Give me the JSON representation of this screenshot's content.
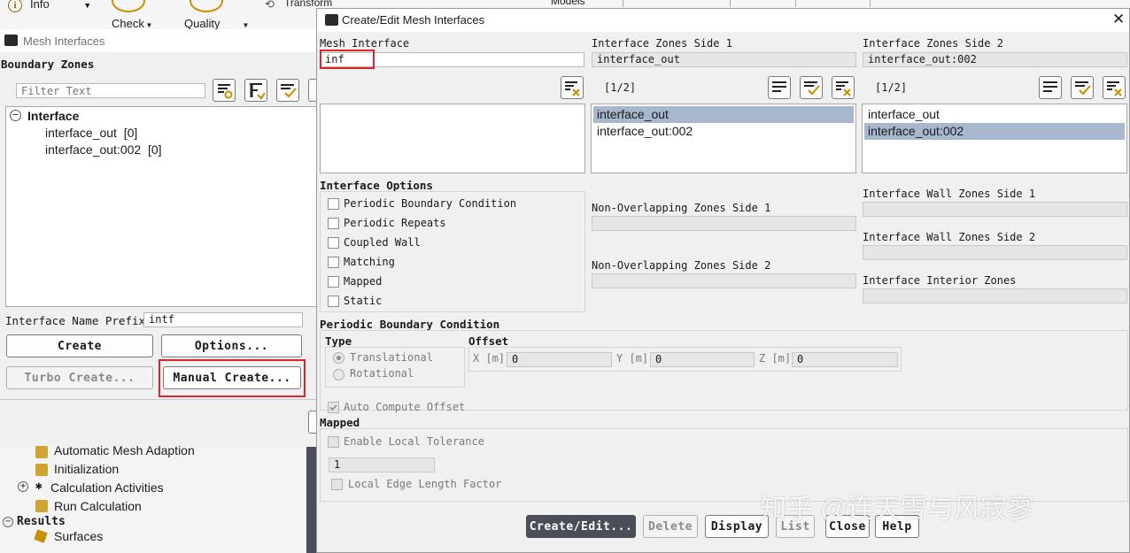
{
  "ribbon": {
    "info_label": "Info",
    "check_label": "Check",
    "quality_label": "Quality",
    "transform_label": "Transform",
    "models_label": "Models"
  },
  "mesh_interfaces": {
    "title": "Mesh Interfaces",
    "boundary_zones_label": "Boundary Zones",
    "filter_placeholder": "Filter Text",
    "tree": {
      "group": "Interface",
      "items": [
        "interface_out  [0]",
        "interface_out:002  [0]"
      ]
    },
    "name_prefix_label": "Interface Name Prefix",
    "name_prefix_value": "intf",
    "create_label": "Create",
    "options_label": "Options...",
    "turbo_create_label": "Turbo Create...",
    "manual_create_label": "Manual Create..."
  },
  "outline": {
    "items": [
      "Automatic Mesh Adaption",
      "Initialization",
      "Calculation Activities",
      "Run Calculation"
    ],
    "results_label": "Results",
    "surfaces_label": "Surfaces"
  },
  "dialog": {
    "title": "Create/Edit Mesh Interfaces",
    "mesh_interface_label": "Mesh Interface",
    "mesh_interface_value": "inf",
    "side1_label": "Interface Zones Side 1",
    "side1_value": "interface_out",
    "side2_label": "Interface Zones Side 2",
    "side2_value": "interface_out:002",
    "side1_count": "[1/2]",
    "side2_count": "[1/2]",
    "side1_list": [
      "interface_out",
      "interface_out:002"
    ],
    "side2_list": [
      "interface_out",
      "interface_out:002"
    ],
    "interface_options_label": "Interface Options",
    "options": [
      "Periodic Boundary Condition",
      "Periodic Repeats",
      "Coupled Wall",
      "Matching",
      "Mapped",
      "Static"
    ],
    "non_overlap1_label": "Non-Overlapping Zones Side 1",
    "non_overlap2_label": "Non-Overlapping Zones Side 2",
    "wall1_label": "Interface Wall Zones Side 1",
    "wall2_label": "Interface Wall Zones Side 2",
    "interior_label": "Interface Interior Zones",
    "periodic_label": "Periodic Boundary Condition",
    "type_label": "Type",
    "translational_label": "Translational",
    "rotational_label": "Rotational",
    "offset_label": "Offset",
    "x_label": "X [m]",
    "y_label": "Y [m]",
    "z_label": "Z [m]",
    "x_value": "0",
    "y_value": "0",
    "z_value": "0",
    "auto_offset_label": "Auto Compute Offset",
    "mapped_label": "Mapped",
    "local_tolerance_label": "Enable Local Tolerance",
    "tolerance_value": "1",
    "edge_length_label": "Local Edge Length Factor",
    "buttons": {
      "create_edit": "Create/Edit...",
      "delete": "Delete",
      "display": "Display",
      "list": "List",
      "close": "Close",
      "help": "Help"
    }
  },
  "watermark": "知乎 @连天雪与风寂寥",
  "colors": {
    "selection": "#a7b7cd",
    "highlight_red": "#d9262b",
    "primary_button": "#4a4e57"
  }
}
